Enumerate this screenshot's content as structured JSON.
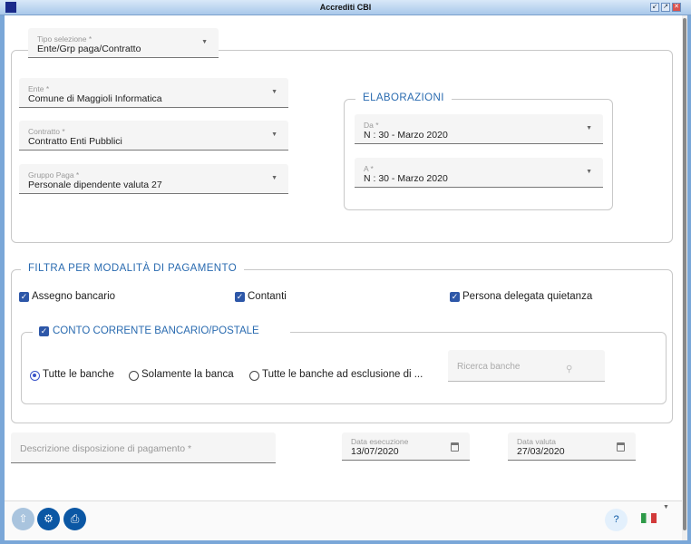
{
  "window": {
    "title": "Accrediti CBI"
  },
  "tipo_selezione": {
    "label": "Tipo selezione *",
    "value": "Ente/Grp paga/Contratto"
  },
  "ente": {
    "label": "Ente *",
    "value": "Comune di Maggioli Informatica"
  },
  "contratto": {
    "label": "Contratto *",
    "value": "Contratto Enti Pubblici"
  },
  "gruppo_paga": {
    "label": "Gruppo Paga *",
    "value": "Personale dipendente valuta 27"
  },
  "elaborazioni": {
    "legend": "ELABORAZIONI",
    "da": {
      "label": "Da *",
      "value": "N : 30 - Marzo 2020"
    },
    "a": {
      "label": "A *",
      "value": "N : 30 - Marzo 2020"
    }
  },
  "filtra": {
    "legend": "FILTRA PER MODALITÀ DI PAGAMENTO",
    "checkboxes": [
      {
        "label": "Assegno bancario",
        "checked": true
      },
      {
        "label": "Contanti",
        "checked": true
      },
      {
        "label": "Persona delegata quietanza",
        "checked": true
      }
    ],
    "conto": {
      "label": "CONTO CORRENTE BANCARIO/POSTALE",
      "checked": true,
      "radios": [
        {
          "label": "Tutte le banche",
          "selected": true
        },
        {
          "label": "Solamente la banca",
          "selected": false
        },
        {
          "label": "Tutte le banche ad esclusione di ...",
          "selected": false
        }
      ],
      "ricerca_placeholder": "Ricerca banche"
    }
  },
  "descrizione": {
    "placeholder": "Descrizione disposizione di pagamento *"
  },
  "data_esecuzione": {
    "label": "Data esecuzione",
    "value": "13/07/2020"
  },
  "data_valuta": {
    "label": "Data valuta",
    "value": "27/03/2020"
  }
}
